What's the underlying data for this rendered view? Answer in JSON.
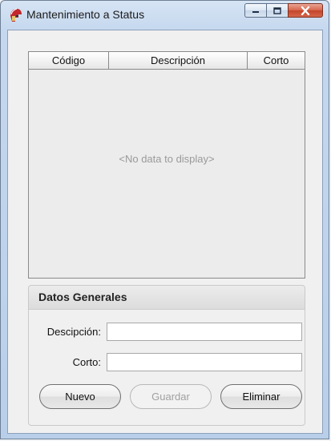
{
  "window": {
    "title": "Mantenimiento a Status",
    "app_icon": "red-warrior-helmet-icon",
    "caption_buttons": [
      "minimize-icon",
      "maximize-icon",
      "close-icon"
    ]
  },
  "grid": {
    "columns": [
      "Código",
      "Descripción",
      "Corto"
    ],
    "rows": [],
    "empty_text": "<No data to display>"
  },
  "form": {
    "group_title": "Datos Generales",
    "descripcion_label": "Descipción:",
    "descripcion_value": "",
    "corto_label": "Corto:",
    "corto_value": ""
  },
  "buttons": {
    "nuevo": "Nuevo",
    "guardar": "Guardar",
    "eliminar": "Eliminar",
    "guardar_enabled": false
  },
  "colors": {
    "close_button": "#c2452b",
    "frame": "#b9cfe9"
  }
}
